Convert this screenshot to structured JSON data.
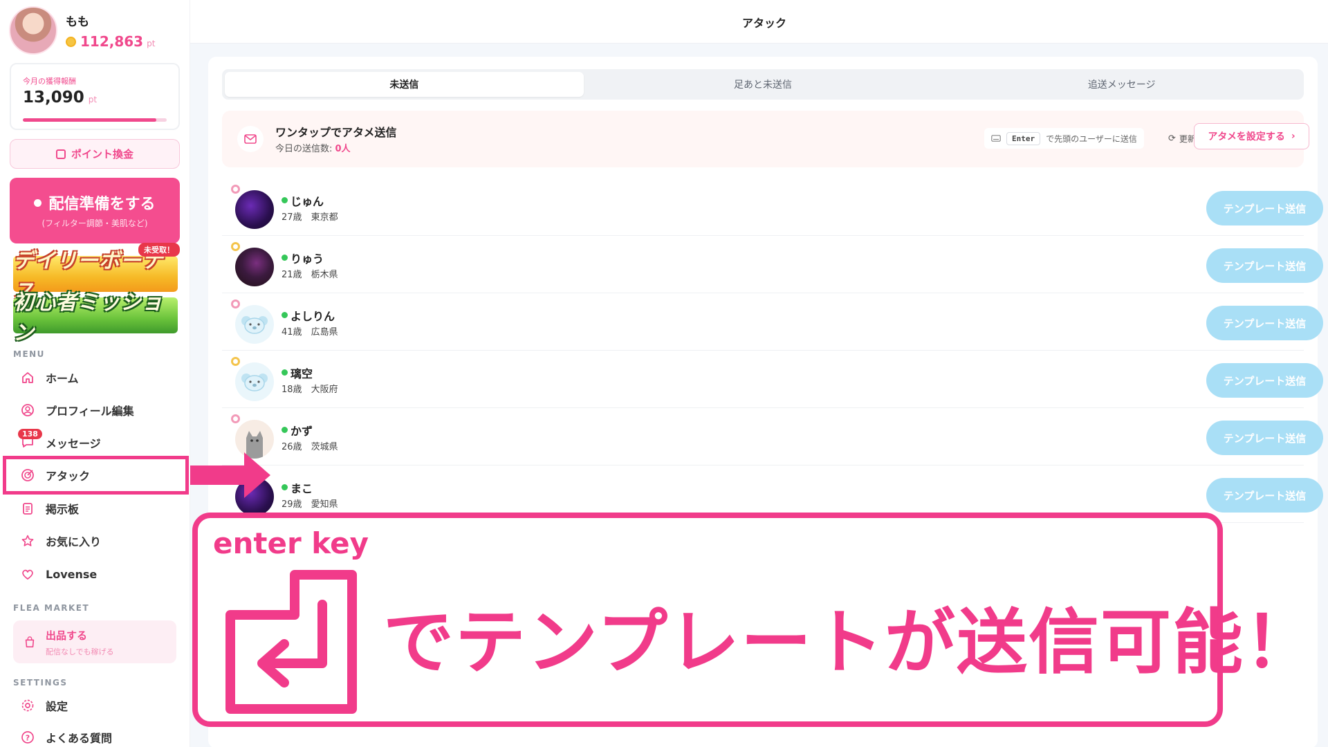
{
  "app": {
    "user": {
      "name": "もも",
      "points": "112,863",
      "points_unit": "pt"
    },
    "earnings": {
      "label": "今月の獲得報酬",
      "value": "13,090",
      "unit": "pt",
      "progress": 0.93
    },
    "exchange_button": "ポイント換金",
    "stream_button": {
      "title": "配信準備をする",
      "subtitle": "(フィルター調節・美肌など)"
    },
    "banners": {
      "daily": "デイリーボーナス",
      "beginner": "初心者ミッション",
      "unclaimed_badge": "未受取！"
    },
    "menu_section": "MENU",
    "menu": [
      {
        "label": "ホーム",
        "icon": "home-icon"
      },
      {
        "label": "プロフィール編集",
        "icon": "profile-icon"
      },
      {
        "label": "メッセージ",
        "icon": "message-icon",
        "badge": "138"
      },
      {
        "label": "アタック",
        "icon": "target-icon",
        "active": true
      },
      {
        "label": "掲示板",
        "icon": "board-icon"
      },
      {
        "label": "お気に入り",
        "icon": "star-icon"
      },
      {
        "label": "Lovense",
        "icon": "heart-icon"
      }
    ],
    "flea_section": "FLEA MARKET",
    "flea": {
      "title": "出品する",
      "subtitle": "配信なしでも稼げる"
    },
    "settings_section": "SETTINGS",
    "settings_menu": [
      {
        "label": "設定",
        "icon": "gear-icon"
      },
      {
        "label": "よくある質問",
        "icon": "help-icon"
      }
    ]
  },
  "main": {
    "title": "アタック",
    "tabs": [
      {
        "label": "未送信",
        "active": true
      },
      {
        "label": "足あと未送信",
        "active": false
      },
      {
        "label": "追送メッセージ",
        "active": false
      }
    ],
    "onetap": {
      "title": "ワンタップでアタメ送信",
      "count_label": "今日の送信数: ",
      "count_value": "0人",
      "key": "Enter",
      "key_hint": "で先頭のユーザーに送信",
      "refresh": "更新",
      "set_button": "アタメを設定する"
    },
    "send_label": "テンプレート送信",
    "users": [
      {
        "name": "じゅん",
        "age": "27歳",
        "location": "東京都",
        "ring": "pink",
        "avatar": "purple"
      },
      {
        "name": "りゅう",
        "age": "21歳",
        "location": "栃木県",
        "ring": "gold",
        "avatar": "dark"
      },
      {
        "name": "よしりん",
        "age": "41歳",
        "location": "広島県",
        "ring": "pink",
        "avatar": "koala"
      },
      {
        "name": "璃空",
        "age": "18歳",
        "location": "大阪府",
        "ring": "gold",
        "avatar": "koala"
      },
      {
        "name": "かず",
        "age": "26歳",
        "location": "茨城県",
        "ring": "pink",
        "avatar": "cat"
      },
      {
        "name": "まこ",
        "age": "29歳",
        "location": "愛知県",
        "ring": "none",
        "avatar": "purple"
      }
    ]
  },
  "annotation": {
    "key_label": "enter key",
    "message": "でテンプレートが送信可能！"
  },
  "colors": {
    "accent": "#f0488c",
    "annotation": "#f13b8a",
    "send_button": "#a9dff6"
  }
}
